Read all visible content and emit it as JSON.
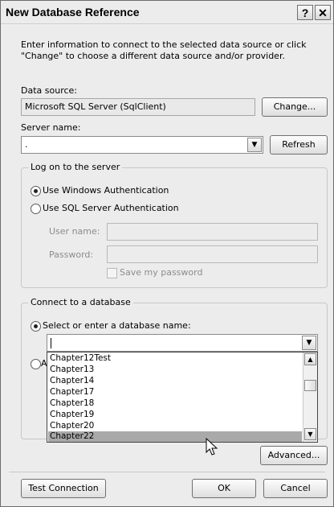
{
  "window": {
    "title": "New Database Reference",
    "help_glyph": "?",
    "close_glyph": "✕"
  },
  "intro_text": "Enter information to connect to the selected data source or click \"Change\" to choose a different data source and/or provider.",
  "data_source": {
    "label": "Data source:",
    "value": "Microsoft SQL Server (SqlClient)",
    "change_label": "Change..."
  },
  "server": {
    "label": "Server name:",
    "value": ".",
    "refresh_label": "Refresh"
  },
  "logon": {
    "group_title": "Log on to the server",
    "windows_auth_label": "Use Windows Authentication",
    "windows_auth_selected": true,
    "sql_auth_label": "Use SQL Server Authentication",
    "sql_auth_selected": false,
    "username_label": "User name:",
    "username_value": "",
    "password_label": "Password:",
    "password_value": "",
    "save_password_label": "Save my password"
  },
  "connect": {
    "group_title": "Connect to a database",
    "select_db_label": "Select or enter a database name:",
    "select_db_selected": true,
    "db_value": "",
    "attach_radio_label_partial": "A",
    "db_list": [
      "Chapter12Test",
      "Chapter13",
      "Chapter14",
      "Chapter17",
      "Chapter18",
      "Chapter19",
      "Chapter20",
      "Chapter22"
    ],
    "db_list_selected": "Chapter22"
  },
  "buttons": {
    "advanced": "Advanced...",
    "test_connection": "Test Connection",
    "ok": "OK",
    "cancel": "Cancel"
  },
  "icons": {
    "dropdown": "chevron-down-icon",
    "scroll_up": "chevron-up-icon",
    "scroll_down": "chevron-down-icon",
    "pointer": "mouse-pointer-icon"
  }
}
